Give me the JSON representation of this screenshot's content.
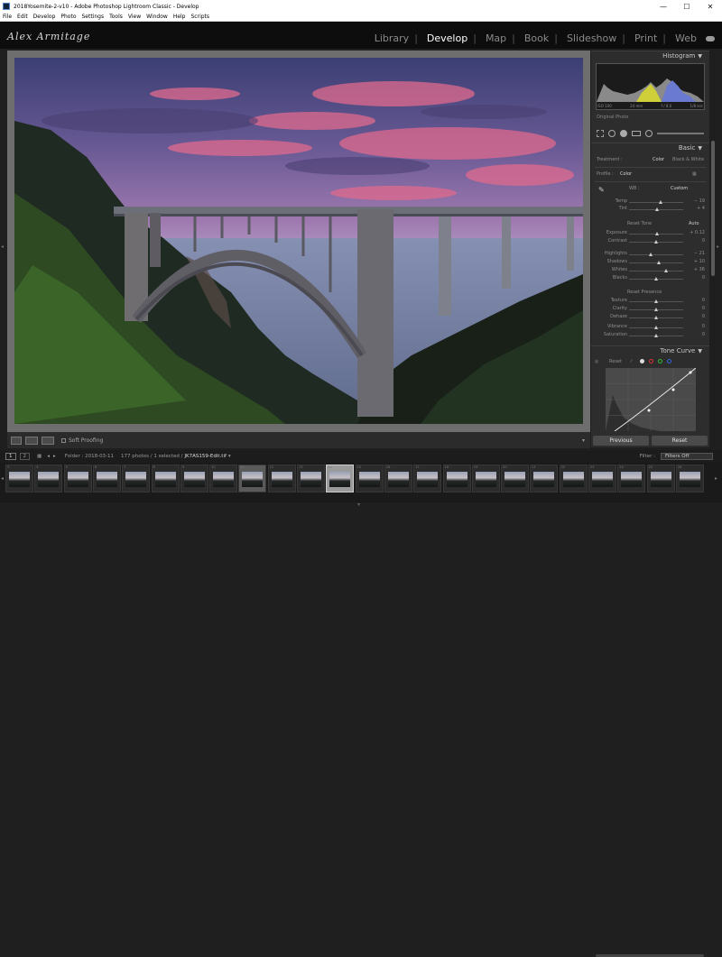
{
  "window": {
    "title": "2018Yosemite-2-v10 - Adobe Photoshop Lightroom Classic - Develop",
    "controls": [
      "—",
      "☐",
      "✕"
    ]
  },
  "menu": [
    "File",
    "Edit",
    "Develop",
    "Photo",
    "Settings",
    "Tools",
    "View",
    "Window",
    "Help",
    "Scripts"
  ],
  "identity_plate": "Alex Armitage",
  "modules": [
    "Library",
    "Develop",
    "Map",
    "Book",
    "Slideshow",
    "Print",
    "Web"
  ],
  "active_module": "Develop",
  "toolbar": {
    "soft_proofing_label": "Soft Proofing"
  },
  "right_panel": {
    "histogram": {
      "title": "Histogram",
      "info": [
        "ISO 100",
        "24 mm",
        "f / 8.0",
        "1/8 sec"
      ],
      "original_photo": "Original Photo"
    },
    "basic": {
      "title": "Basic",
      "treatment_label": "Treatment :",
      "treatment_color": "Color",
      "treatment_bw": "Black & White",
      "profile_label": "Profile :",
      "profile_value": "Color",
      "wb_label": "WB :",
      "wb_value": "Custom",
      "tone_label": "Reset Tone",
      "auto_label": "Auto",
      "presence_label": "Reset Presence",
      "sliders": [
        {
          "label": "Temp",
          "value": "− 19",
          "pos": 0.58
        },
        {
          "label": "Tint",
          "value": "+ 4",
          "pos": 0.52
        },
        {
          "label": "Exposure",
          "value": "+ 0.12",
          "pos": 0.52
        },
        {
          "label": "Contrast",
          "value": "0",
          "pos": 0.5
        },
        {
          "label": "Highlights",
          "value": "− 21",
          "pos": 0.4
        },
        {
          "label": "Shadows",
          "value": "+ 10",
          "pos": 0.55
        },
        {
          "label": "Whites",
          "value": "+ 36",
          "pos": 0.68
        },
        {
          "label": "Blacks",
          "value": "0",
          "pos": 0.5
        },
        {
          "label": "Texture",
          "value": "0",
          "pos": 0.5
        },
        {
          "label": "Clarity",
          "value": "0",
          "pos": 0.5
        },
        {
          "label": "Dehaze",
          "value": "0",
          "pos": 0.5
        },
        {
          "label": "Vibrance",
          "value": "0",
          "pos": 0.5
        },
        {
          "label": "Saturation",
          "value": "0",
          "pos": 0.5
        }
      ]
    },
    "tone_curve": {
      "title": "Tone Curve",
      "reset_label": "Reset"
    },
    "previous_button": "Previous",
    "reset_button": "Reset"
  },
  "filmstrip_header": {
    "page1": "1",
    "page2": "2",
    "folder_label": "Folder : 2018-03-11",
    "count_label": "177 photos / 1 selected /",
    "filename": "JK7AS159-Edit.tif",
    "filter_label": "Filter :",
    "filter_value": "Filters Off"
  },
  "filmstrip": {
    "cells": [
      "3",
      "4",
      "5",
      "6",
      "7",
      "8",
      "9",
      "10",
      "11",
      "12",
      "13",
      "14",
      "15",
      "16",
      "17",
      "18",
      "19",
      "20",
      "21",
      "22",
      "23",
      "24",
      "25",
      "26"
    ]
  },
  "colors": {
    "panel_bg": "#2d2d2d",
    "center_bg": "#6e6e6e",
    "active_module": "#ffffff",
    "inactive_module": "#8a8a8a"
  }
}
